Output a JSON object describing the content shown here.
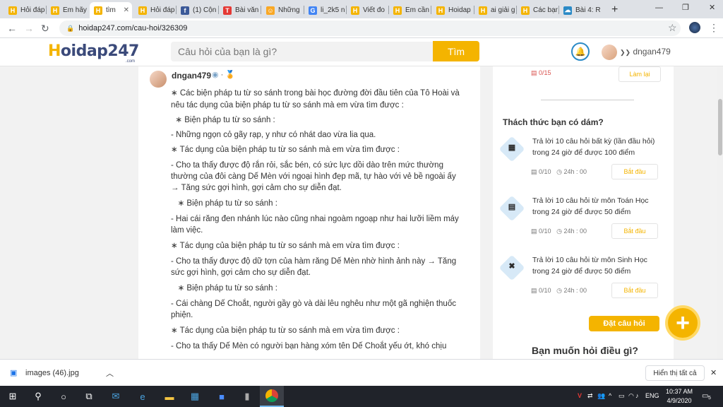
{
  "browser": {
    "tabs": [
      {
        "label": "Hỏi đáp",
        "fav": "H",
        "color": "#f4b400"
      },
      {
        "label": "Em hãy",
        "fav": "H",
        "color": "#f4b400"
      },
      {
        "label": "tìm",
        "fav": "H",
        "color": "#f4b400",
        "active": true
      },
      {
        "label": "Hỏi đáp",
        "fav": "H",
        "color": "#f4b400"
      },
      {
        "label": "(1) Cộn",
        "fav": "f",
        "color": "#3b5998"
      },
      {
        "label": "Bài văn",
        "fav": "T",
        "color": "#e53935"
      },
      {
        "label": "Những",
        "fav": "☺",
        "color": "#f9a825"
      },
      {
        "label": "li_2k5 n",
        "fav": "G",
        "color": "#4285f4"
      },
      {
        "label": "Viết đo",
        "fav": "H",
        "color": "#f4b400"
      },
      {
        "label": "Em cần",
        "fav": "H",
        "color": "#f4b400"
      },
      {
        "label": "Hoidap",
        "fav": "H",
        "color": "#f4b400"
      },
      {
        "label": "ai giải g",
        "fav": "H",
        "color": "#f4b400"
      },
      {
        "label": "Các bạn",
        "fav": "H",
        "color": "#f4b400"
      },
      {
        "label": "Bài 4: R",
        "fav": "☁",
        "color": "#2b8ac6"
      }
    ],
    "new_tab": "+",
    "url": "hoidap247.com/cau-hoi/326309",
    "window_controls": [
      "—",
      "❐",
      "✕"
    ]
  },
  "site": {
    "logo_h": "H",
    "logo_rest": "oidap247",
    "logo_sub": ".com",
    "search_placeholder": "Câu hỏi của bạn là gì?",
    "search_button": "Tìm",
    "username": "dngan479"
  },
  "answer": {
    "username": "dngan479",
    "badges": "◉ · 🏅",
    "lines": [
      "∗ Các biện pháp tu từ so sánh trong bài học đường đời đầu tiên của Tô Hoài và",
      "nêu tác dụng của biện pháp tu từ so sánh mà em vừa tìm được :",
      "  ∗ Biện pháp tu từ so sánh :",
      "- Những ngọn cỏ gãy rạp, y như có nhát dao vừa lia qua.",
      "∗ Tác dụng của biện pháp tu từ so sánh mà em vừa tìm được :",
      "- Cho ta thấy được độ rắn rỏi, sắc bén, có sức lực dồi dào trên mức thường",
      "thường của đôi càng Dế Mèn với ngoại hình đẹp mã, tự hào với vẻ bề ngoài ấy",
      "→ Tăng sức gợi hình, gợi cảm cho sự diễn đạt.",
      "   ∗ Biện pháp tu từ so sánh :",
      "- Hai cái răng đen nhánh lúc nào cũng nhai ngoàm ngoạp như hai lưỡi liềm máy",
      "làm việc.",
      "∗ Tác dụng của biện pháp tu từ so sánh mà em vừa tìm được :",
      "- Cho ta thấy được độ dữ tợn của hàm răng Dế Mèn nhờ hình ảnh này → Tăng",
      "sức gợi hình, gợi cảm cho sự diễn đạt.",
      "   ∗ Biện pháp tu từ so sánh :",
      "- Cái chàng Dế Choắt, người gầy gò và dài lêu nghêu như một gã nghiện thuốc",
      "phiện.",
      "∗ Tác dụng của biện pháp tu từ so sánh mà em vừa tìm được :",
      "- Cho ta thấy Dế Mèn có người bạn hàng xóm tên Dế Choắt yếu ớt, khó chịu"
    ]
  },
  "sidebar": {
    "top_progress": "0/15",
    "top_button": "Làm lại",
    "challenge_title": "Thách thức bạn có dám?",
    "challenges": [
      {
        "icon": "▦",
        "line1": "Trả lời 10 câu hỏi  bất kỳ (lần đầu hỏi)",
        "line2": "trong 24 giờ để được 100 điểm",
        "progress": "0/10",
        "time": "24h : 00",
        "button": "Bắt đầu"
      },
      {
        "icon": "▤",
        "line1": "Trả lời 10 câu hỏi  từ môn Toán Học",
        "line2": "trong 24 giờ để được 50 điểm",
        "progress": "0/10",
        "time": "24h : 00",
        "button": "Bắt đầu"
      },
      {
        "icon": "✖",
        "line1": "Trả lời 10 câu hỏi  từ môn Sinh Học",
        "line2": "trong 24 giờ để được 50 điểm",
        "progress": "0/10",
        "time": "24h : 00",
        "button": "Bắt đầu"
      }
    ],
    "ask_label": "Đặt câu hỏi",
    "ask_heading": "Bạn muốn hỏi điều gì?"
  },
  "download": {
    "filename": "images (46).jpg",
    "show_all": "Hiển thị tất cả"
  },
  "taskbar": {
    "lang": "ENG",
    "time": "10:37 AM",
    "date": "4/9/2020",
    "notif": "5"
  }
}
